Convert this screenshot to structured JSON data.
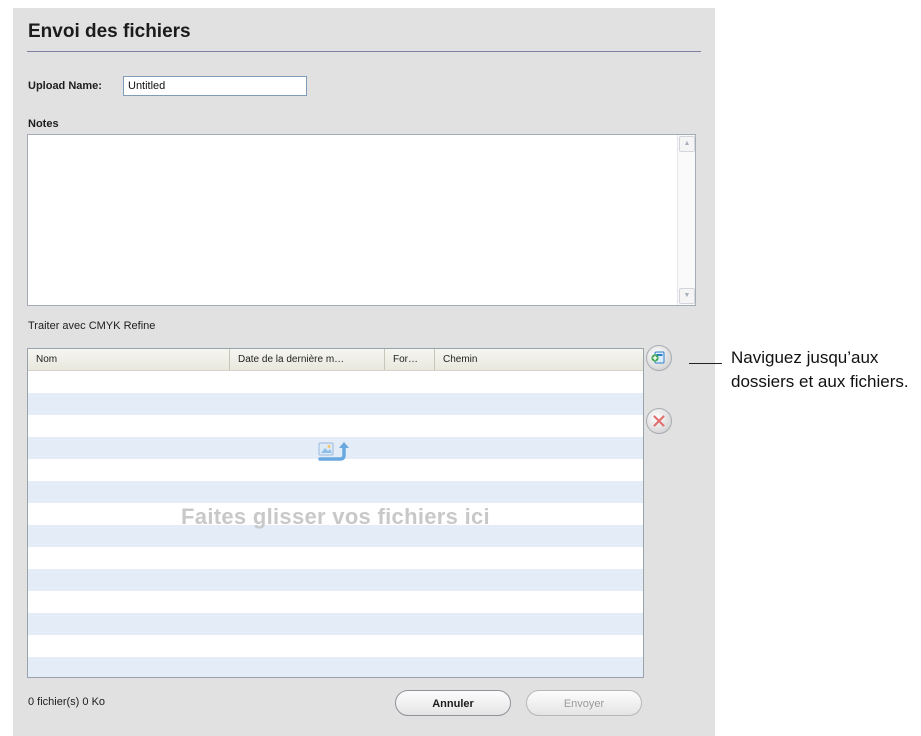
{
  "dialog": {
    "title": "Envoi des fichiers",
    "upload_name_label": "Upload Name:",
    "upload_name_value": "Untitled",
    "notes_label": "Notes",
    "notes_value": "",
    "process_label": "Traiter avec",
    "process_value": "CMYK Refine"
  },
  "file_table": {
    "columns": [
      "Nom",
      "Date de la dernière m…",
      "For…",
      "Chemin"
    ],
    "rows": [],
    "drop_hint": "Faites glisser vos fichiers ici"
  },
  "side_buttons": {
    "add_icon": "add-file-icon",
    "remove_icon": "remove-icon"
  },
  "footer": {
    "file_count": "0 fichier(s) 0 Ko",
    "cancel_label": "Annuler",
    "send_label": "Envoyer",
    "send_enabled": false
  },
  "callout": {
    "text": "Naviguez jusqu’aux dossiers et aux fichiers."
  },
  "colors": {
    "panel_bg": "#e1e1e1",
    "row_stripe": "#e3ecf7",
    "title_rule": "#7d7fa3",
    "remove_x": "#e07070",
    "add_icon_blue": "#2f7fc8",
    "add_icon_green": "#3aa64a"
  }
}
